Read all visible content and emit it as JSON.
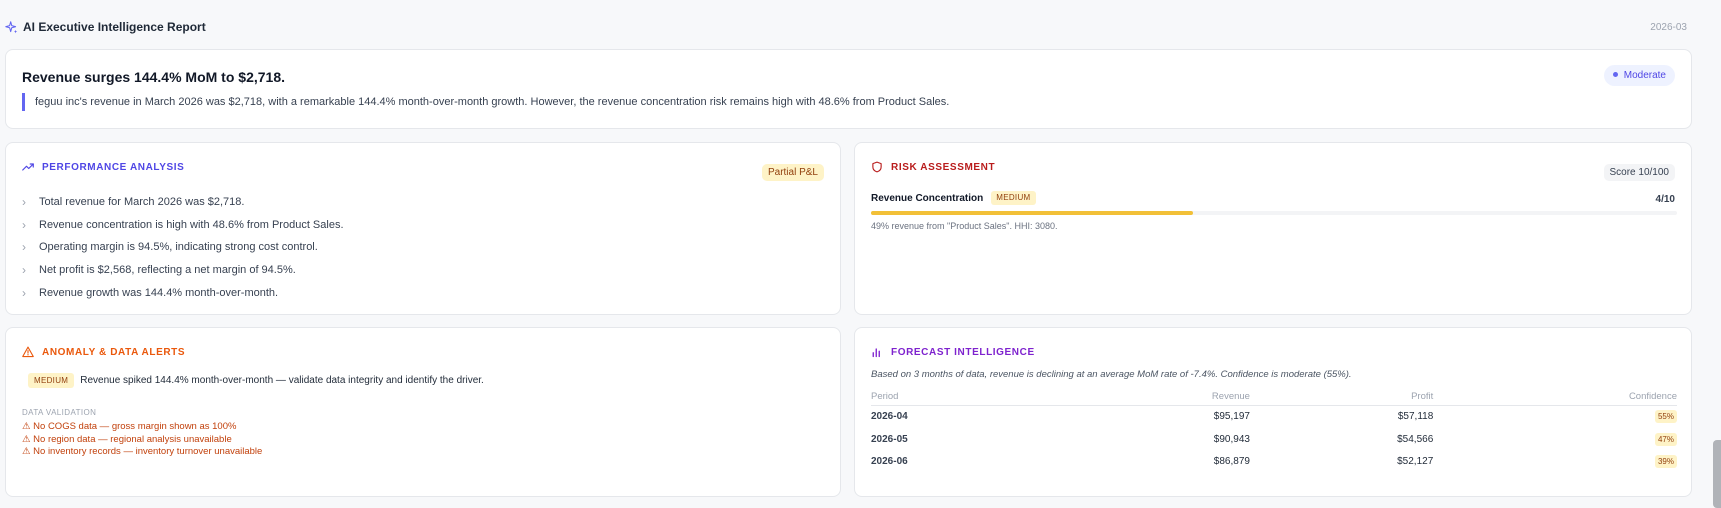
{
  "report": {
    "title": "AI Executive Intelligence Report",
    "period": "2026-03",
    "icon": "sparkles-icon"
  },
  "summary": {
    "headline": "Revenue surges 144.4% MoM to $2,718.",
    "body": "feguu inc's revenue in March 2026 was $2,718, with a remarkable 144.4% month-over-month growth. However, the revenue concentration risk remains high with 48.6% from Product Sales.",
    "confidence_badge": "Moderate",
    "accent_color": "#6366f1"
  },
  "performance": {
    "title": "PERFORMANCE ANALYSIS",
    "badge": "Partial P&L",
    "icon": "trending-up-icon",
    "items": [
      "Total revenue for March 2026 was $2,718.",
      "Revenue concentration is high with 48.6% from Product Sales.",
      "Operating margin is 94.5%, indicating strong cost control.",
      "Net profit is $2,568, reflecting a net margin of 94.5%.",
      "Revenue growth was 144.4% month-over-month."
    ]
  },
  "risk": {
    "title": "RISK ASSESSMENT",
    "icon": "shield-icon",
    "score_label": "Score 10/100",
    "items": [
      {
        "name": "Revenue Concentration",
        "level": "MEDIUM",
        "score": "4/10",
        "score_fraction": 0.4,
        "detail": "49% revenue from \"Product Sales\". HHI: 3080."
      }
    ]
  },
  "anomaly": {
    "title": "ANOMALY & DATA ALERTS",
    "icon": "warning-icon",
    "alerts": [
      {
        "level": "MEDIUM",
        "text": "Revenue spiked 144.4% month-over-month — validate data integrity and identify the driver."
      }
    ],
    "validation_title": "DATA VALIDATION",
    "validation": [
      "⚠ No COGS data — gross margin shown as 100%",
      "⚠ No region data — regional analysis unavailable",
      "⚠ No inventory records — inventory turnover unavailable"
    ]
  },
  "forecast": {
    "title": "FORECAST INTELLIGENCE",
    "icon": "bar-chart-icon",
    "description": "Based on 3 months of data, revenue is declining at an average MoM rate of -7.4%. Confidence is moderate (55%).",
    "columns": [
      "Period",
      "Revenue",
      "Profit",
      "Confidence"
    ],
    "rows": [
      [
        "2026-04",
        "$95,197",
        "$57,118",
        "55%"
      ],
      [
        "2026-05",
        "$90,943",
        "$54,566",
        "47%"
      ],
      [
        "2026-06",
        "$86,879",
        "$52,127",
        "39%"
      ]
    ]
  }
}
